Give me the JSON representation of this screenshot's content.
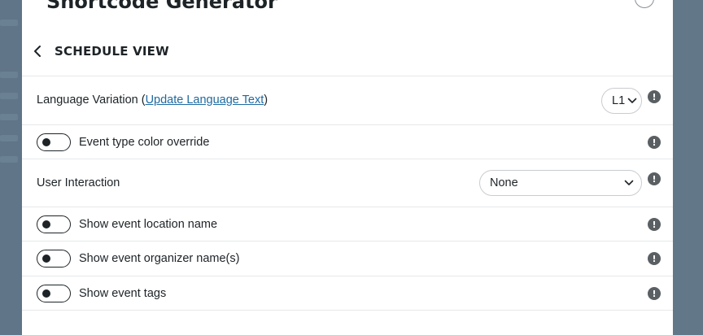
{
  "modal": {
    "title": "Shortcode Generator",
    "section_title": "SCHEDULE VIEW"
  },
  "rows": {
    "language": {
      "label_prefix": "Language Variation (",
      "link_text": "Update Language Text",
      "label_suffix": ")",
      "selected": "L1"
    },
    "event_type_color": {
      "label": "Event type color override",
      "enabled": false
    },
    "user_interaction": {
      "label": "User Interaction",
      "selected": "None"
    },
    "location_name": {
      "label": "Show event location name",
      "enabled": false
    },
    "organizer_names": {
      "label": "Show event organizer name(s)",
      "enabled": false
    },
    "event_tags": {
      "label": "Show event tags",
      "enabled": false
    }
  },
  "info_glyph": "!",
  "colors": {
    "text": "#1d2327",
    "link": "#1e6aa1",
    "info": "#5a5f63",
    "backdrop": "#607587"
  },
  "icons": [
    "chevron-left-icon",
    "chevron-down-icon",
    "info-icon",
    "close-icon"
  ]
}
